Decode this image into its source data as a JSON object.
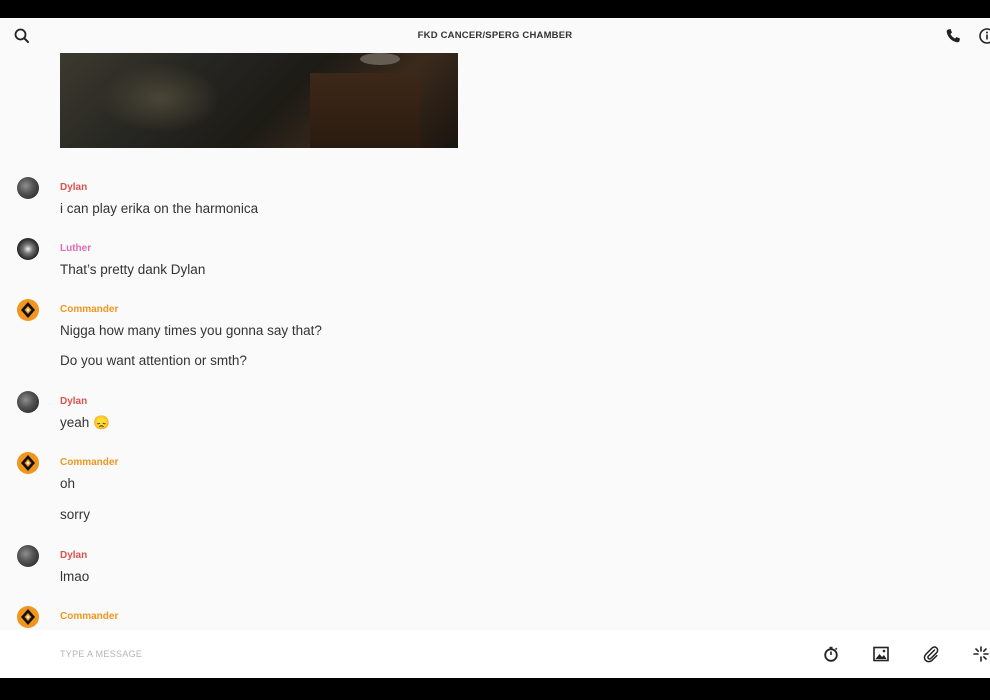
{
  "header": {
    "title": "FKD CANCER/SPERG CHAMBER",
    "icons": [
      "search-icon",
      "phone-icon",
      "info-icon"
    ]
  },
  "messages": [
    {
      "sender": "Dylan",
      "lines": [
        "i can play erika on the harmonica"
      ]
    },
    {
      "sender": "Luther",
      "lines": [
        "That’s pretty dank Dylan"
      ]
    },
    {
      "sender": "Commander",
      "lines": [
        "Nigga how many times you gonna say that?",
        "Do you want attention or smth?"
      ]
    },
    {
      "sender": "Dylan",
      "lines": [
        "yeah 😞"
      ]
    },
    {
      "sender": "Commander",
      "lines": [
        "oh",
        "sorry"
      ]
    },
    {
      "sender": "Dylan",
      "lines": [
        "lmao"
      ]
    },
    {
      "sender": "Commander",
      "lines": []
    }
  ],
  "composer": {
    "placeholder": "TYPE A MESSAGE",
    "icons": [
      "timer-icon",
      "image-icon",
      "attachment-icon",
      "sparkle-icon"
    ]
  },
  "colors": {
    "dylan": "#d9534f",
    "luther": "#e06bb0",
    "commander": "#f0961e",
    "background": "#fafafa"
  }
}
